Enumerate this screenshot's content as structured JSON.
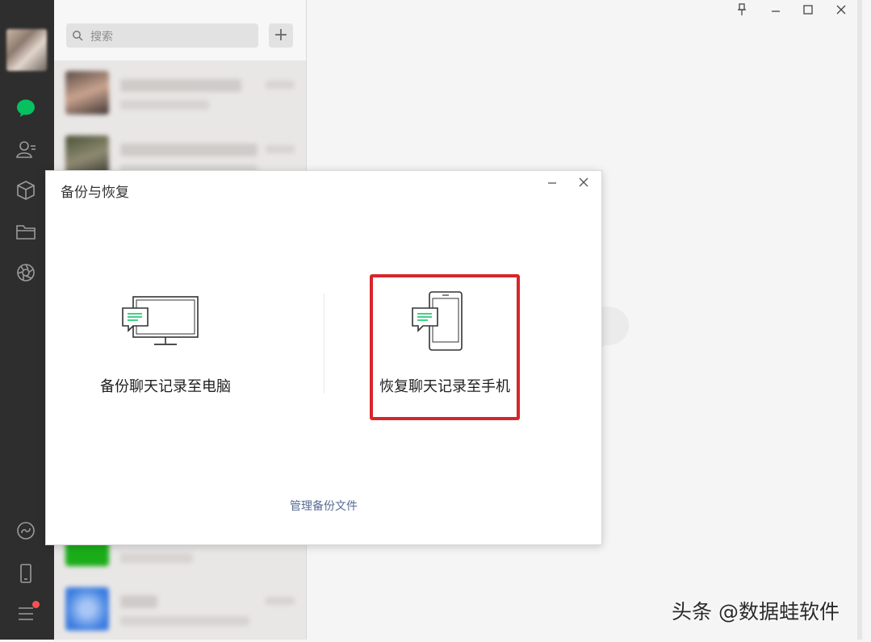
{
  "window": {
    "controls": [
      "pin",
      "minimize",
      "maximize",
      "close"
    ]
  },
  "sidebar": {
    "icons": [
      "chat-icon",
      "contacts-icon",
      "favorites-icon",
      "files-icon",
      "moments-icon",
      "mini-programs-icon",
      "phone-icon",
      "menu-icon"
    ],
    "active_color": "#07c160",
    "badge_color": "#fa5151"
  },
  "chat_list": {
    "search_placeholder": "搜索",
    "add_label": "+"
  },
  "dialog": {
    "title": "备份与恢复",
    "backup_label": "备份聊天记录至电脑",
    "restore_label": "恢复聊天记录至手机",
    "manage_label": "管理备份文件",
    "highlight_color": "#d7262b"
  },
  "watermark": "头条 @数据蛙软件"
}
